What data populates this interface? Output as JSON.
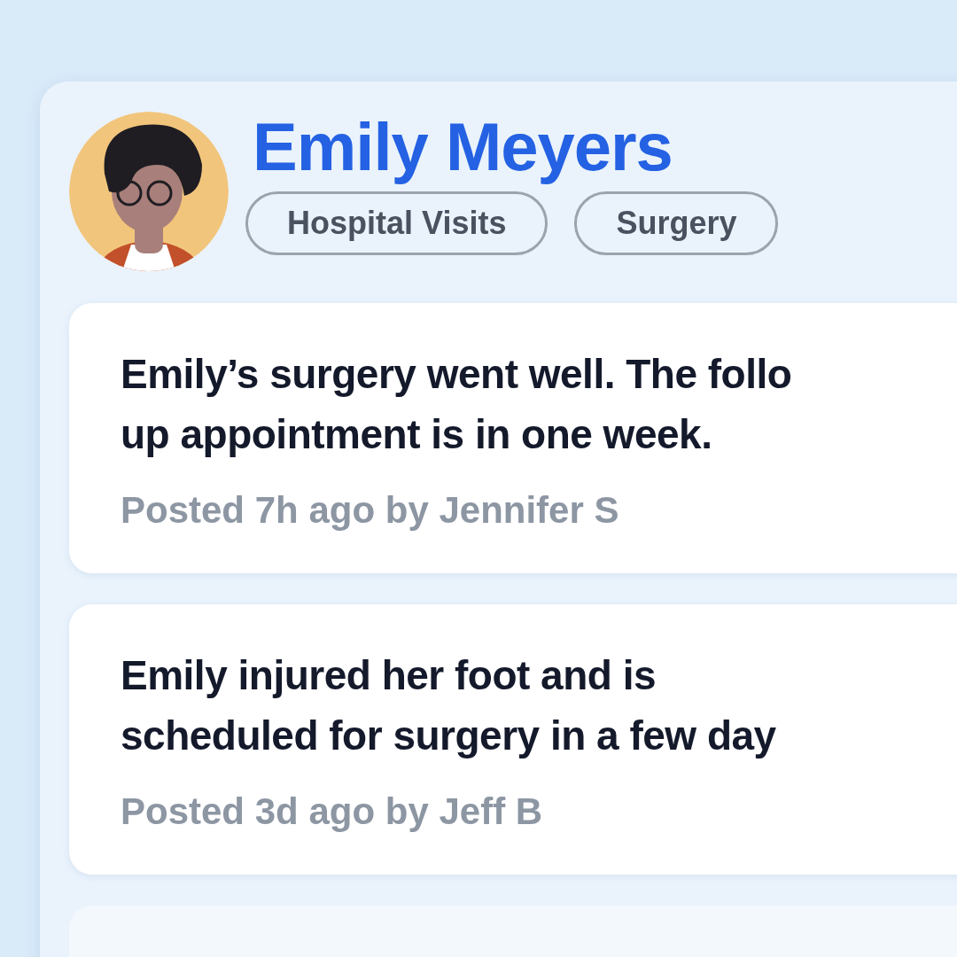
{
  "profile": {
    "name": "Emily Meyers",
    "tags": [
      "Hospital Visits",
      "Surgery"
    ]
  },
  "posts": [
    {
      "lines": [
        "Emily’s surgery went well. The follo",
        "up appointment is in one week."
      ],
      "meta": "Posted **7h ago** by **Jennifer S**"
    },
    {
      "lines": [
        "Emily injured her foot and is",
        "scheduled for surgery in a few day"
      ],
      "meta": "Posted **3d ago** by **Jeff B**"
    }
  ]
}
